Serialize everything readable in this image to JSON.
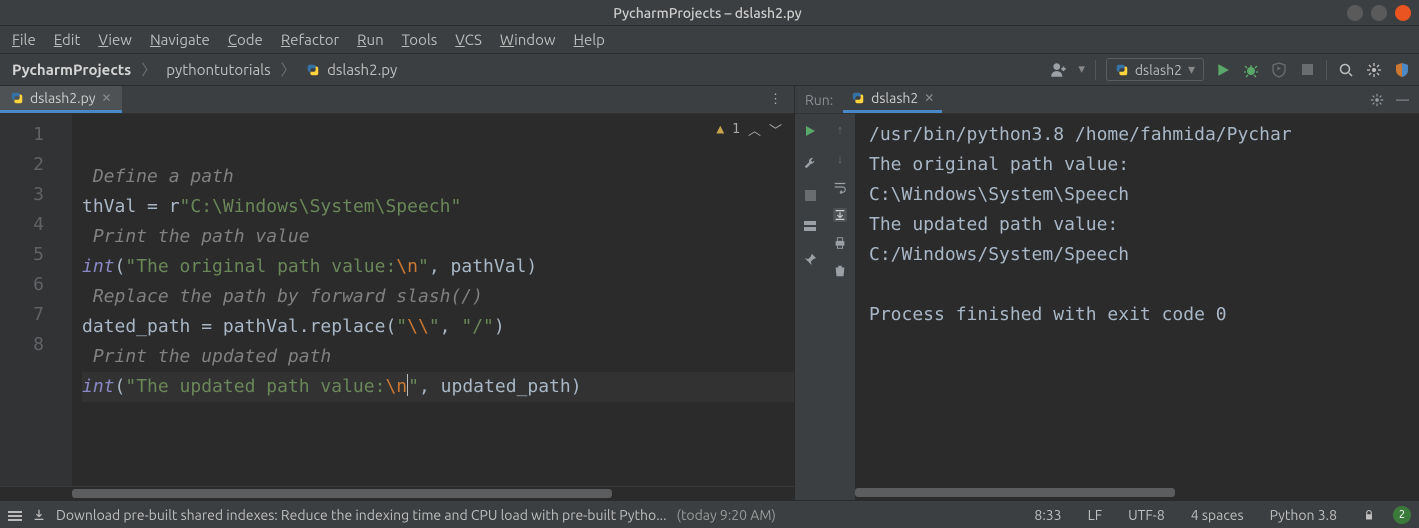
{
  "window": {
    "title": "PycharmProjects – dslash2.py"
  },
  "menu": [
    "File",
    "Edit",
    "View",
    "Navigate",
    "Code",
    "Refactor",
    "Run",
    "Tools",
    "VCS",
    "Window",
    "Help"
  ],
  "breadcrumbs": {
    "root": "PycharmProjects",
    "folder": "pythontutorials",
    "file": "dslash2.py"
  },
  "run_config": {
    "name": "dslash2"
  },
  "toolbar_icons": [
    "add-user",
    "run",
    "debug",
    "coverage",
    "stop",
    "search",
    "settings",
    "shield"
  ],
  "editor": {
    "tab": {
      "filename": "dslash2.py"
    },
    "inspection": {
      "warnings": "1"
    },
    "lines": [
      {
        "num": "1",
        "frags": [
          [
            "comment",
            " Define a path"
          ]
        ]
      },
      {
        "num": "2",
        "frags": [
          [
            "ident",
            "thVal"
          ],
          [
            "op",
            " = r"
          ],
          [
            "str",
            "\"C:\\Windows\\System\\Speech\""
          ]
        ]
      },
      {
        "num": "3",
        "frags": [
          [
            "comment",
            " Print the path value"
          ]
        ]
      },
      {
        "num": "4",
        "frags": [
          [
            "func",
            "int"
          ],
          [
            "op",
            "("
          ],
          [
            "str",
            "\"The original path value:"
          ],
          [
            "esc",
            "\\n"
          ],
          [
            "str",
            "\""
          ],
          [
            "op",
            ", "
          ],
          [
            "ident",
            "pathVal"
          ],
          [
            "op",
            ")"
          ]
        ]
      },
      {
        "num": "5",
        "frags": [
          [
            "comment",
            " Replace the path by forward slash(/)"
          ]
        ]
      },
      {
        "num": "6",
        "frags": [
          [
            "ident",
            "dated_path"
          ],
          [
            "op",
            " = "
          ],
          [
            "ident",
            "pathVal"
          ],
          [
            "op",
            "."
          ],
          [
            "ident",
            "replace"
          ],
          [
            "op",
            "("
          ],
          [
            "str",
            "\""
          ],
          [
            "esc",
            "\\\\"
          ],
          [
            "str",
            "\""
          ],
          [
            "op",
            ", "
          ],
          [
            "str",
            "\"/\""
          ],
          [
            "op",
            ")"
          ]
        ]
      },
      {
        "num": "7",
        "frags": [
          [
            "comment",
            " Print the updated path"
          ]
        ]
      },
      {
        "num": "8",
        "current": true,
        "frags": [
          [
            "func",
            "int"
          ],
          [
            "op",
            "("
          ],
          [
            "str",
            "\"The updated path value:"
          ],
          [
            "esc",
            "\\n"
          ],
          [
            "caret",
            ""
          ],
          [
            "str",
            "\""
          ],
          [
            "op",
            ", "
          ],
          [
            "ident",
            "updated_path"
          ],
          [
            "op",
            ")"
          ]
        ]
      }
    ]
  },
  "run": {
    "label": "Run:",
    "tab": "dslash2",
    "output": [
      "/usr/bin/python3.8 /home/fahmida/Pychar",
      "The original path value:",
      " C:\\Windows\\System\\Speech",
      "The updated path value:",
      " C:/Windows/System/Speech",
      "",
      "Process finished with exit code 0"
    ]
  },
  "status": {
    "download_icon": "download-icon",
    "message": "Download pre-built shared indexes: Reduce the indexing time and CPU load with pre-built Pytho...",
    "time": "(today 9:20 AM)",
    "pos": "8:33",
    "sep": "LF",
    "enc": "UTF-8",
    "indent": "4 spaces",
    "interp": "Python 3.8",
    "notif": "2"
  }
}
